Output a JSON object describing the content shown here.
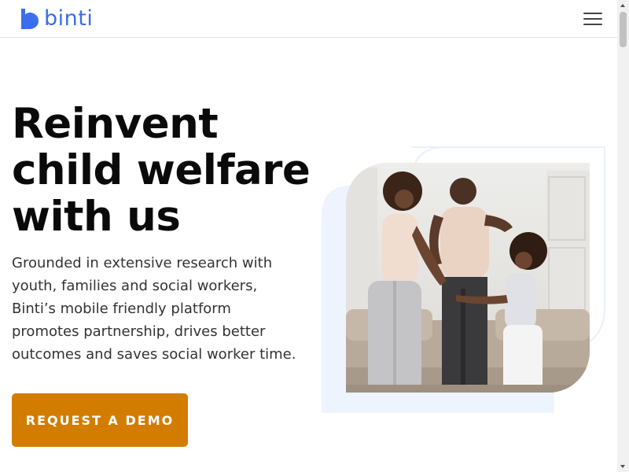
{
  "brand": {
    "name": "binti",
    "color": "#3b6ee8"
  },
  "nav": {
    "menu_icon": "hamburger-icon"
  },
  "hero": {
    "title": "Reinvent child welfare with us",
    "description": "Grounded in extensive research with youth, families and social workers, Binti’s mobile friendly platform promotes partnership, drives better outcomes and saves social worker time.",
    "cta_label": "REQUEST A DEMO",
    "cta_color": "#d37d00"
  },
  "image": {
    "subject": "family-photo-icon"
  }
}
